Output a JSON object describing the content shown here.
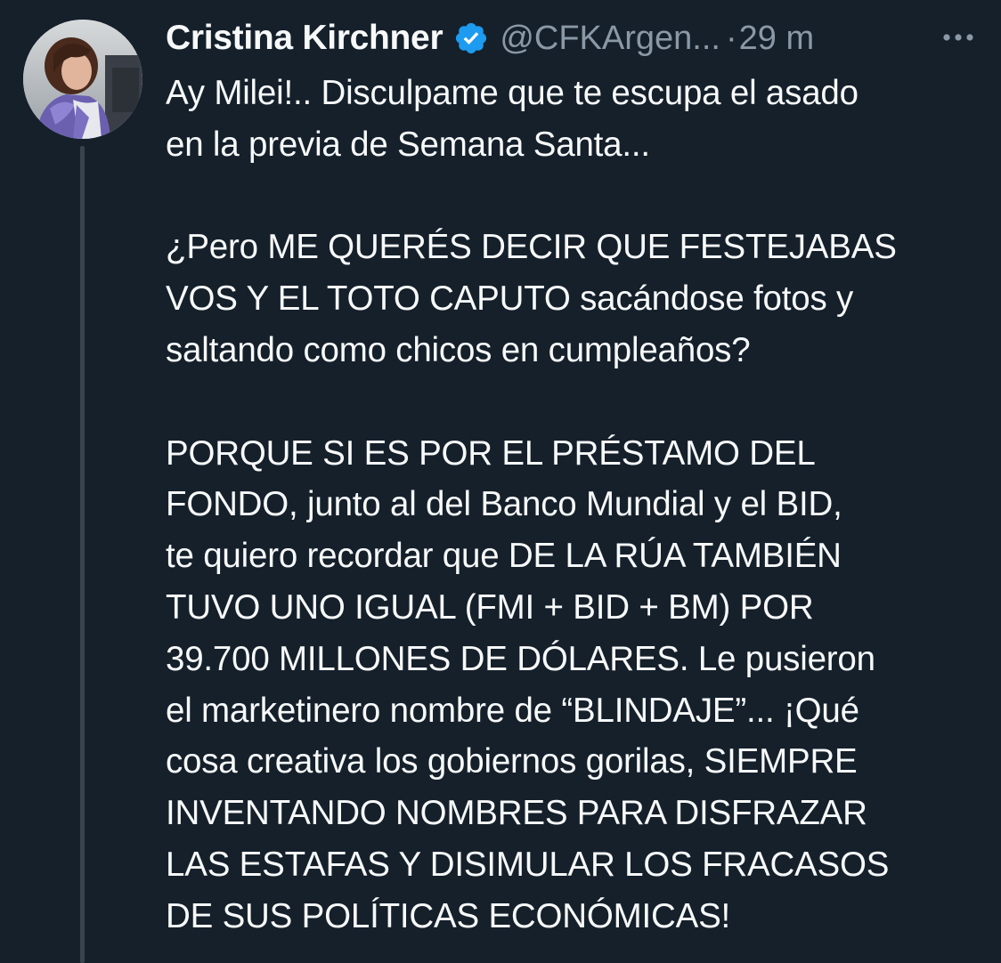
{
  "tweet": {
    "author": {
      "display_name": "Cristina Kirchner",
      "handle": "@CFKArgen...",
      "verified": true,
      "avatar_icon": "profile-photo"
    },
    "time_separator": "·",
    "timestamp": "29 m",
    "more_icon": "ellipsis-icon",
    "verified_color": "#1d9bf0",
    "text_lines": [
      "Ay Milei!.. Disculpame que te escupa el asado",
      "en la previa de Semana Santa...",
      "",
      "¿Pero ME QUERÉS DECIR QUE FESTEJABAS",
      "VOS Y EL TOTO CAPUTO sacándose fotos y",
      "saltando como chicos en cumpleaños?",
      "",
      "PORQUE SI ES POR EL PRÉSTAMO DEL",
      "FONDO, junto al del Banco Mundial y el BID,",
      "te quiero recordar que DE LA RÚA TAMBIÉN",
      "TUVO UNO IGUAL (FMI + BID + BM) POR",
      "39.700 MILLONES DE DÓLARES. Le pusieron",
      "el marketinero nombre de “BLINDAJE”... ¡Qué",
      "cosa creativa los gobiernos gorilas, SIEMPRE",
      "INVENTANDO NOMBRES PARA DISFRAZAR",
      "LAS ESTAFAS Y DISIMULAR LOS FRACASOS",
      "DE SUS POLÍTICAS ECONÓMICAS!"
    ]
  },
  "colors": {
    "background": "#15202b",
    "text": "#f7f9f9",
    "secondary_text": "#8b98a5",
    "thread_line": "#38444d"
  }
}
